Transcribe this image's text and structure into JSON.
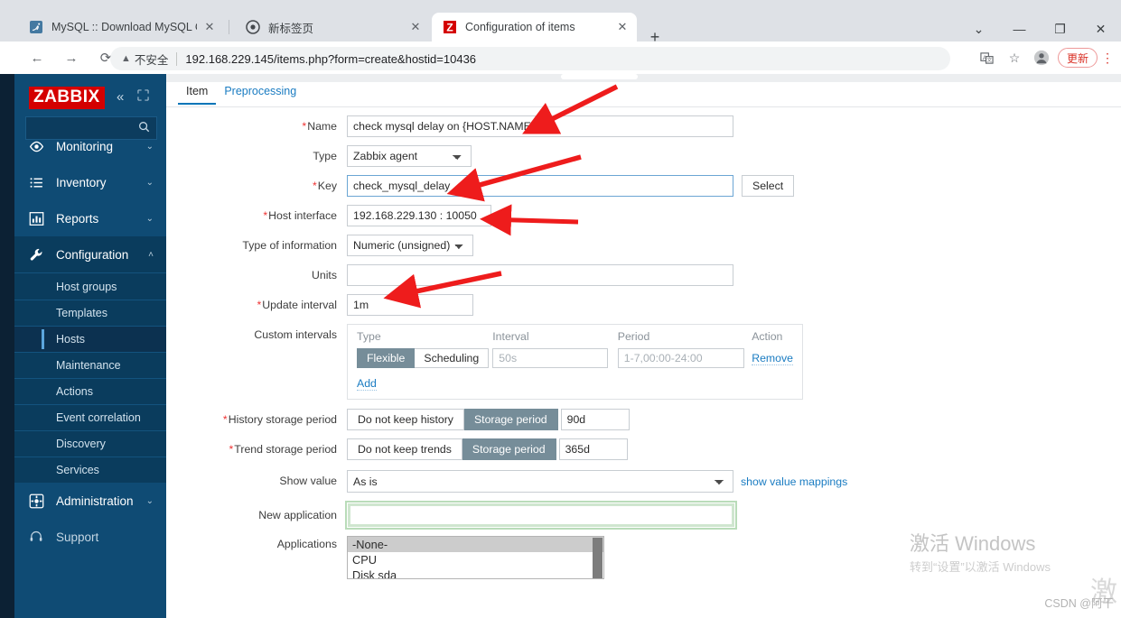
{
  "browser": {
    "tabs": [
      {
        "title": "MySQL :: Download MySQL Co",
        "favicon": "mysql-dolphin-icon",
        "active": false
      },
      {
        "title": "新标签页",
        "favicon": "chrome-globe-icon",
        "active": false
      },
      {
        "title": "Configuration of items",
        "favicon": "zabbix-z-icon",
        "active": true
      }
    ],
    "new_tab_label": "+",
    "window_controls": {
      "minimize": "—",
      "maximize": "❐",
      "close": "✕",
      "more": "⌄"
    },
    "nav": {
      "back": "←",
      "forward": "→",
      "reload": "⟳"
    },
    "omnibox": {
      "warning_icon": "warning-triangle-icon",
      "security_label": "不安全",
      "url": "192.168.229.145/items.php?form=create&hostid=10436"
    },
    "actions": {
      "translate": "translate-icon",
      "bookmark": "star-icon",
      "profile": "profile-avatar-icon",
      "update_label": "更新",
      "menu": "⋮"
    }
  },
  "sidebar": {
    "logo": "ZABBIX",
    "collapse_icon": "«",
    "hide_icon": "❐",
    "search_placeholder": "",
    "items": [
      {
        "label": "Monitoring",
        "icon": "eye-icon",
        "chevron": "⌄",
        "expanded": false
      },
      {
        "label": "Inventory",
        "icon": "list-icon",
        "chevron": "⌄",
        "expanded": false
      },
      {
        "label": "Reports",
        "icon": "bar-chart-icon",
        "chevron": "⌄",
        "expanded": false
      },
      {
        "label": "Configuration",
        "icon": "wrench-icon",
        "chevron": "˄",
        "expanded": true
      }
    ],
    "config_subitems": [
      {
        "label": "Host groups",
        "selected": false
      },
      {
        "label": "Templates",
        "selected": false
      },
      {
        "label": "Hosts",
        "selected": true
      },
      {
        "label": "Maintenance",
        "selected": false
      },
      {
        "label": "Actions",
        "selected": false
      },
      {
        "label": "Event correlation",
        "selected": false
      },
      {
        "label": "Discovery",
        "selected": false
      },
      {
        "label": "Services",
        "selected": false
      }
    ],
    "bottom_items": [
      {
        "label": "Administration",
        "icon": "gear-icon",
        "chevron": "⌄"
      },
      {
        "label": "Support",
        "icon": "headset-icon",
        "chevron": ""
      }
    ]
  },
  "form": {
    "tabs": [
      {
        "label": "Item",
        "active": true
      },
      {
        "label": "Preprocessing",
        "active": false
      }
    ],
    "fields": {
      "name": {
        "label": "Name",
        "required": true,
        "value": "check mysql delay on {HOST.NAME}"
      },
      "type": {
        "label": "Type",
        "required": false,
        "value": "Zabbix agent"
      },
      "key": {
        "label": "Key",
        "required": true,
        "value": "check_mysql_delay",
        "button": "Select"
      },
      "host_interface": {
        "label": "Host interface",
        "required": true,
        "value": "192.168.229.130 : 10050"
      },
      "type_of_information": {
        "label": "Type of information",
        "required": false,
        "value": "Numeric (unsigned)"
      },
      "units": {
        "label": "Units",
        "required": false,
        "value": ""
      },
      "update_interval": {
        "label": "Update interval",
        "required": true,
        "value": "1m"
      },
      "custom_intervals": {
        "label": "Custom intervals",
        "headers": [
          "Type",
          "Interval",
          "Period",
          "Action"
        ],
        "rows": [
          {
            "type_options": [
              "Flexible",
              "Scheduling"
            ],
            "type_selected": "Flexible",
            "interval_placeholder": "50s",
            "interval_value": "",
            "period_placeholder": "1-7,00:00-24:00",
            "period_value": "",
            "action": "Remove"
          }
        ],
        "add_link": "Add"
      },
      "history_storage_period": {
        "label": "History storage period",
        "required": true,
        "options": [
          "Do not keep history",
          "Storage period"
        ],
        "selected": "Storage period",
        "value": "90d"
      },
      "trend_storage_period": {
        "label": "Trend storage period",
        "required": true,
        "options": [
          "Do not keep trends",
          "Storage period"
        ],
        "selected": "Storage period",
        "value": "365d"
      },
      "show_value": {
        "label": "Show value",
        "required": false,
        "value": "As is",
        "link": "show value mappings"
      },
      "new_application": {
        "label": "New application",
        "required": false,
        "value": ""
      },
      "applications": {
        "label": "Applications",
        "options": [
          "-None-",
          "CPU",
          "Disk sda"
        ],
        "selected": "-None-"
      }
    }
  },
  "watermark": {
    "line1": "激活 Windows",
    "line2": "转到“设置”以激活 Windows",
    "credit": "CSDN @阿干",
    "credit_big": "激"
  }
}
